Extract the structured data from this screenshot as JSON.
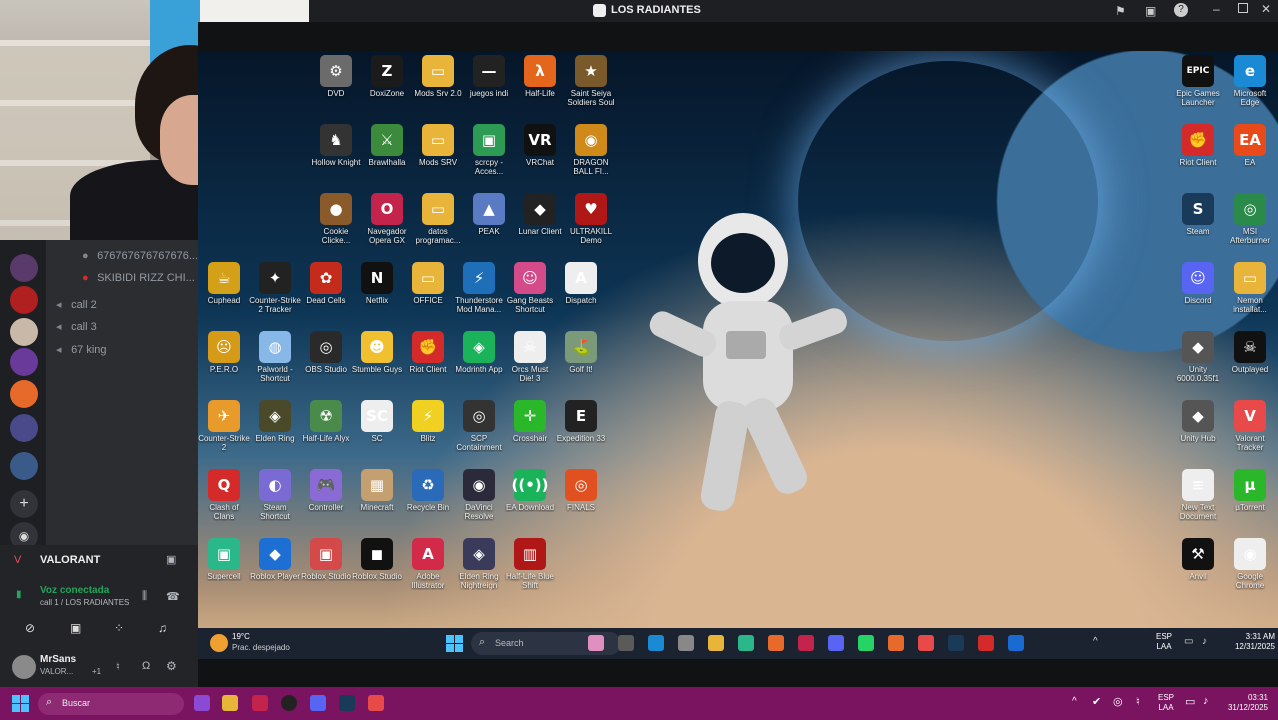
{
  "stream": {
    "title": "LOS RADIANTES"
  },
  "discord": {
    "channels": [
      {
        "label": "676767676767676...",
        "type": "user"
      },
      {
        "label": "SKIBIDI RIZZ CHI...",
        "type": "user"
      },
      {
        "label": "call 2",
        "type": "voice"
      },
      {
        "label": "call 3",
        "type": "voice"
      },
      {
        "label": "67 king",
        "type": "voice"
      }
    ],
    "activity": "VALORANT",
    "voice_status": "Voz conectada",
    "voice_channel": "call 1 / LOS RADIANTES",
    "user_name": "MrSans",
    "user_status": "VALOR...",
    "user_extra": "+1"
  },
  "desktop_icons": [
    {
      "label": "DVD",
      "color": "#6b6b6b",
      "g": "⚙"
    },
    {
      "label": "DoxiZone",
      "color": "#1b1b1b",
      "g": "Z"
    },
    {
      "label": "Mods Srv 2.0",
      "color": "#e8b43a",
      "g": "▭"
    },
    {
      "label": "juegos indi",
      "color": "#222",
      "g": "—"
    },
    {
      "label": "Half-Life",
      "color": "#e3661c",
      "g": "λ"
    },
    {
      "label": "Saint Seiya Soldiers Soul",
      "color": "#7a5a2a",
      "g": "★"
    },
    {
      "label": "Hollow Knight",
      "color": "#333",
      "g": "♞"
    },
    {
      "label": "Brawlhalla",
      "color": "#3c8a3c",
      "g": "⚔"
    },
    {
      "label": "Mods SRV",
      "color": "#e8b43a",
      "g": "▭"
    },
    {
      "label": "scrcpy - Acces...",
      "color": "#2e9b55",
      "g": "▣"
    },
    {
      "label": "VRChat",
      "color": "#111",
      "g": "VR"
    },
    {
      "label": "DRAGON BALL FI...",
      "color": "#d08a1a",
      "g": "◉"
    },
    {
      "label": "Cookie Clicke...",
      "color": "#8a5a2a",
      "g": "●"
    },
    {
      "label": "Navegador Opera GX",
      "color": "#c4234b",
      "g": "O"
    },
    {
      "label": "datos programac...",
      "color": "#e8b43a",
      "g": "▭"
    },
    {
      "label": "PEAK",
      "color": "#5a7ac4",
      "g": "▲"
    },
    {
      "label": "Lunar Client",
      "color": "#222",
      "g": "◆"
    },
    {
      "label": "ULTRAKILL Demo",
      "color": "#b01818",
      "g": "♥"
    },
    {
      "label": "Cuphead",
      "color": "#d4a018",
      "g": "☕"
    },
    {
      "label": "Counter-Strike 2 Tracker",
      "color": "#222",
      "g": "✦"
    },
    {
      "label": "Dead Cells",
      "color": "#c42b1b",
      "g": "✿"
    },
    {
      "label": "Netflix",
      "color": "#111",
      "g": "N"
    },
    {
      "label": "OFFICE",
      "color": "#e8b43a",
      "g": "▭"
    },
    {
      "label": "Thunderstore Mod Mana...",
      "color": "#1e6fb8",
      "g": "⚡"
    },
    {
      "label": "Gang Beasts Shortcut",
      "color": "#d44b8a",
      "g": "☺"
    },
    {
      "label": "Dispatch",
      "color": "#eee",
      "g": "A"
    },
    {
      "label": "P.E.R.O",
      "color": "#d49a18",
      "g": "☹"
    },
    {
      "label": "Palworld - Shortcut",
      "color": "#88b8e8",
      "g": "◍"
    },
    {
      "label": "OBS Studio",
      "color": "#2a2a2a",
      "g": "◎"
    },
    {
      "label": "Stumble Guys",
      "color": "#f0c030",
      "g": "☻"
    },
    {
      "label": "Riot Client",
      "color": "#d42a2a",
      "g": "✊"
    },
    {
      "label": "Modrinth App",
      "color": "#1bb35a",
      "g": "◈"
    },
    {
      "label": "Orcs Must Die! 3",
      "color": "#eee",
      "g": "☠"
    },
    {
      "label": "Golf It!",
      "color": "#7a9a7a",
      "g": "⛳"
    },
    {
      "label": "Counter-Strike 2",
      "color": "#e89a2a",
      "g": "✈"
    },
    {
      "label": "Elden Ring",
      "color": "#4a4a2a",
      "g": "◈"
    },
    {
      "label": "Half-Life Alyx",
      "color": "#4a8a4a",
      "g": "☢"
    },
    {
      "label": "SC",
      "color": "#eee",
      "g": "SC"
    },
    {
      "label": "Blitz",
      "color": "#f0d020",
      "g": "⚡"
    },
    {
      "label": "SCP Containment",
      "color": "#333",
      "g": "◎"
    },
    {
      "label": "Crosshair",
      "color": "#2ab82a",
      "g": "✛"
    },
    {
      "label": "Expedition 33",
      "color": "#222",
      "g": "E"
    },
    {
      "label": "Clash of Clans",
      "color": "#d42a2a",
      "g": "Q"
    },
    {
      "label": "Steam Shortcut",
      "color": "#7a6ad4",
      "g": "◐"
    },
    {
      "label": "Controller",
      "color": "#8a6ad4",
      "g": "🎮"
    },
    {
      "label": "Minecraft",
      "color": "#c4a070",
      "g": "▦"
    },
    {
      "label": "Recycle Bin",
      "color": "#2a6ab8",
      "g": "♻"
    },
    {
      "label": "DaVinci Resolve",
      "color": "#2a2a3a",
      "g": "◉"
    },
    {
      "label": "EA Download",
      "color": "#1bb35a",
      "g": "((•))"
    },
    {
      "label": "FINALS",
      "color": "#e05020",
      "g": "◎"
    },
    {
      "label": "Supercell",
      "color": "#2ab88a",
      "g": "▣"
    },
    {
      "label": "Roblox Player",
      "color": "#1e6fd4",
      "g": "◆"
    },
    {
      "label": "Roblox Studio",
      "color": "#d44a4a",
      "g": "▣"
    },
    {
      "label": "Roblox Studio",
      "color": "#111",
      "g": "◼"
    },
    {
      "label": "Adobe Illustrator",
      "color": "#d42a4a",
      "g": "A"
    },
    {
      "label": "Elden Ring Nightreign",
      "color": "#3a3a5a",
      "g": "◈"
    },
    {
      "label": "Half-Life Blue Shift",
      "color": "#b01818",
      "g": "▥"
    }
  ],
  "right_icons": [
    {
      "label": "Epic Games Launcher",
      "color": "#111",
      "g": "EPIC"
    },
    {
      "label": "Microsoft Edge",
      "color": "#1a8ad4",
      "g": "e"
    },
    {
      "label": "Riot Client",
      "color": "#d42a2a",
      "g": "✊"
    },
    {
      "label": "EA",
      "color": "#e84a1a",
      "g": "EA"
    },
    {
      "label": "Steam",
      "color": "#1a3a5a",
      "g": "S"
    },
    {
      "label": "MSI Afterburner",
      "color": "#2a8a4a",
      "g": "◎"
    },
    {
      "label": "Discord",
      "color": "#5865f2",
      "g": "☺"
    },
    {
      "label": "Nemon installat...",
      "color": "#e8b43a",
      "g": "▭"
    },
    {
      "label": "Unity 6000.0.35f1",
      "color": "#555",
      "g": "◆"
    },
    {
      "label": "Outplayed",
      "color": "#111",
      "g": "☠"
    },
    {
      "label": "Unity Hub",
      "color": "#555",
      "g": "◆"
    },
    {
      "label": "Valorant Tracker",
      "color": "#e84a4a",
      "g": "V"
    },
    {
      "label": "New Text Document",
      "color": "#eee",
      "g": "≡"
    },
    {
      "label": "µTorrent",
      "color": "#2ab82a",
      "g": "µ"
    },
    {
      "label": "Anvil",
      "color": "#111",
      "g": "⚒"
    },
    {
      "label": "Google Chrome",
      "color": "#eee",
      "g": "◉"
    }
  ],
  "inner_taskbar": {
    "weather_temp": "19°C",
    "weather_desc": "Prac. despejado",
    "search_placeholder": "Search",
    "lang": "ESP",
    "lang_sub": "LAA",
    "time": "3:31 AM",
    "date": "12/31/2025"
  },
  "outer_taskbar": {
    "search_placeholder": "Buscar",
    "lang": "ESP",
    "lang_sub": "LAA",
    "time": "03:31",
    "date": "31/12/2025"
  },
  "colors": {
    "outer_taskbar": "#7a1460",
    "discord_green": "#23a55a"
  }
}
